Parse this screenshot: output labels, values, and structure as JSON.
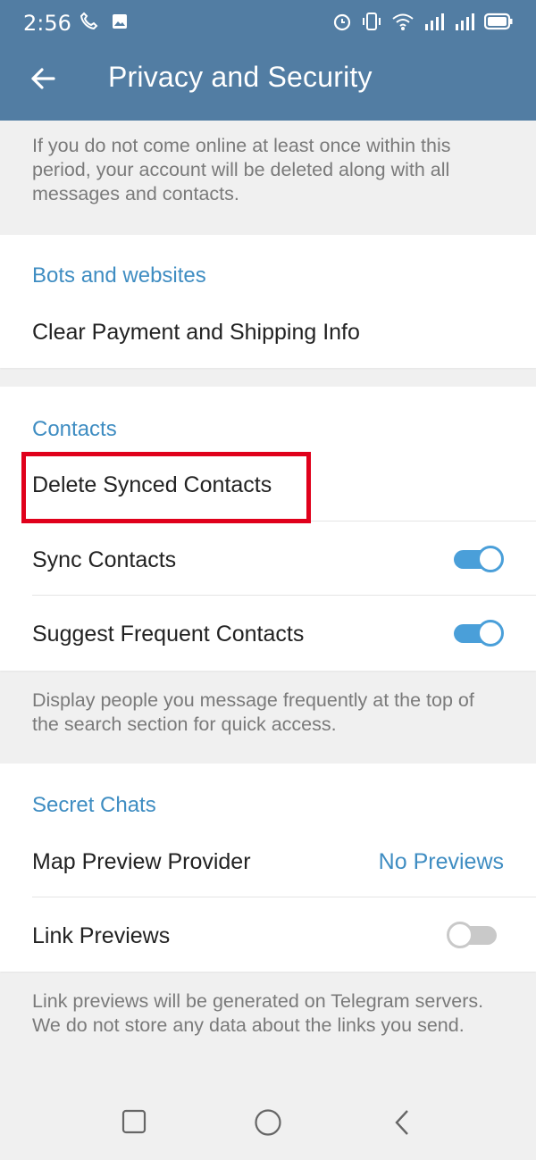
{
  "status_bar": {
    "time": "2:56",
    "left_icons": [
      "phone-settings-icon",
      "image-icon"
    ],
    "right_icons": [
      "alarm-icon",
      "vibrate-icon",
      "wifi-icon",
      "signal-icon",
      "signal-icon",
      "battery-icon"
    ]
  },
  "appbar": {
    "title": "Privacy and Security",
    "back_icon": "arrow-left-icon"
  },
  "account_info": "If you do not come online at least once within this period, your account will be deleted along with all messages and contacts.",
  "bots": {
    "header": "Bots and websites",
    "clear_payment": "Clear Payment and Shipping Info"
  },
  "contacts": {
    "header": "Contacts",
    "delete_synced": "Delete Synced Contacts",
    "sync_contacts": "Sync Contacts",
    "sync_contacts_on": true,
    "suggest_frequent": "Suggest Frequent Contacts",
    "suggest_frequent_on": true,
    "info": "Display people you message frequently at the top of the search section for quick access."
  },
  "secret_chats": {
    "header": "Secret Chats",
    "map_preview_label": "Map Preview Provider",
    "map_preview_value": "No Previews",
    "link_previews": "Link Previews",
    "link_previews_on": false,
    "info": "Link previews will be generated on Telegram servers. We do not store any data about the links you send."
  },
  "colors": {
    "header_bg": "#527da3",
    "accent": "#3f8dc2",
    "highlight": "#e0001b"
  },
  "nav": {
    "icons": [
      "square-icon",
      "circle-icon",
      "back-chevron-icon"
    ]
  }
}
